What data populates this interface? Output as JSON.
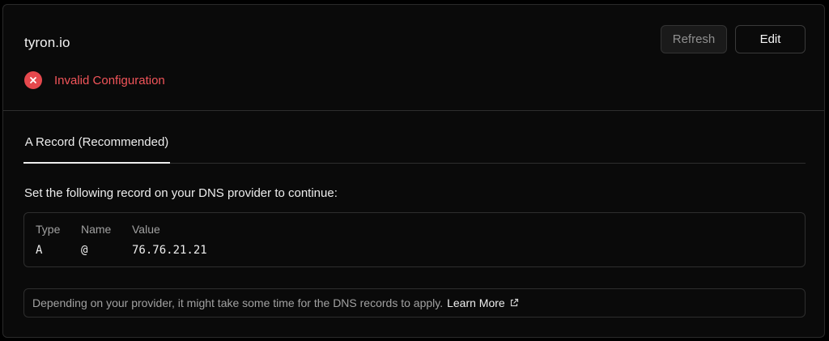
{
  "domain": {
    "name": "tyron.io"
  },
  "actions": {
    "refresh_label": "Refresh",
    "edit_label": "Edit"
  },
  "status": {
    "text": "Invalid Configuration",
    "icon": "x-circle-icon",
    "color": "#e5484d"
  },
  "tabs": [
    {
      "label": "A Record (Recommended)",
      "active": true
    }
  ],
  "instruction": "Set the following record on your DNS provider to continue:",
  "record": {
    "headers": [
      "Type",
      "Name",
      "Value"
    ],
    "values": [
      "A",
      "@",
      "76.76.21.21"
    ]
  },
  "note": {
    "text": "Depending on your provider, it might take some time for the DNS records to apply.",
    "link_label": "Learn More",
    "link_icon": "external-link-icon"
  }
}
